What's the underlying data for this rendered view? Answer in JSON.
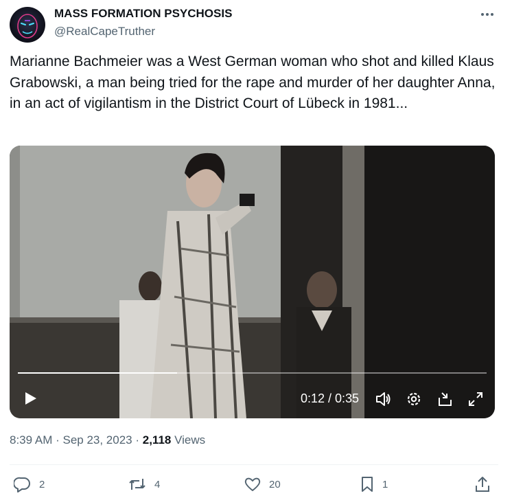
{
  "author": {
    "display_name": "MASS FORMATION PSYCHOSIS",
    "handle": "@RealCapeTruther",
    "avatar_icon": "masked-face-avatar"
  },
  "more_icon": "more-dots-icon",
  "tweet_text": "Marianne Bachmeier was a West German woman who shot and killed Klaus Grabowski, a man being tried for the rape and murder of her daughter Anna, in an act of vigilantism in the District Court of Lübeck in 1981...",
  "video": {
    "progress": 0.34,
    "time_display": "0:12 / 0:35",
    "controls": [
      "play-icon",
      "volume-icon",
      "settings-icon",
      "pop-out-icon",
      "fullscreen-icon"
    ]
  },
  "meta": {
    "time": "8:39 AM",
    "separator": " · ",
    "date": "Sep 23, 2023",
    "views_count": "2,118",
    "views_label": " Views"
  },
  "actions": {
    "replies": "2",
    "retweets": "4",
    "likes": "20",
    "bookmarks": "1"
  },
  "colors": {
    "text": "#0f1419",
    "secondary": "#536471",
    "divider": "#eff3f4",
    "video_controls": "#ffffff"
  }
}
